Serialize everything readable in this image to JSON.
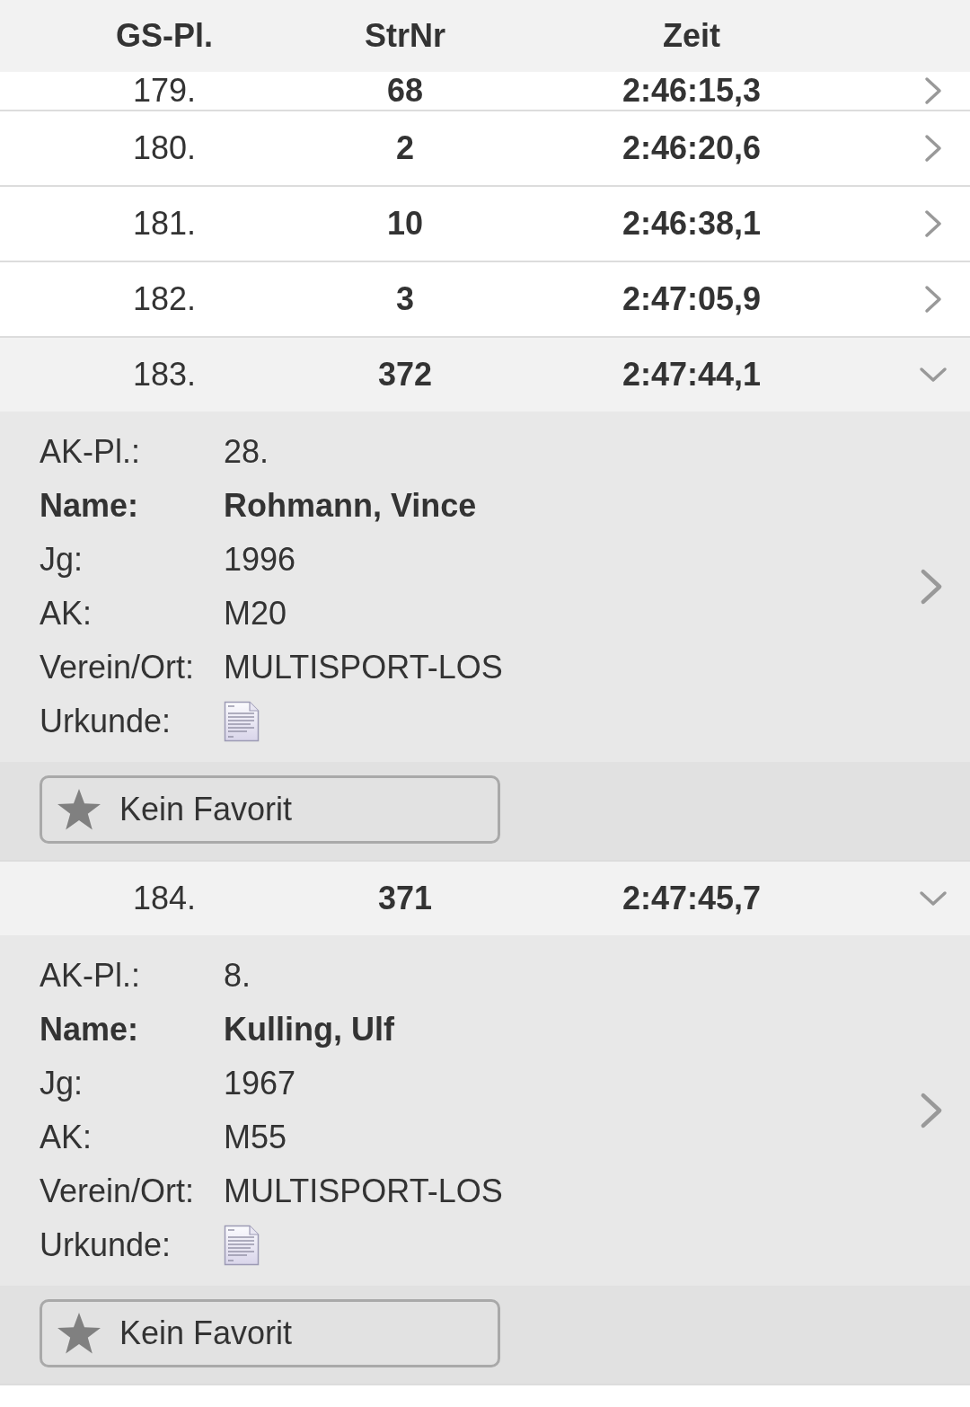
{
  "header": {
    "columns": [
      "GS-Pl.",
      "StrNr",
      "Zeit"
    ]
  },
  "rows": [
    {
      "place": "179.",
      "bib": "68",
      "time": "2:46:15,3",
      "expanded": false
    },
    {
      "place": "180.",
      "bib": "2",
      "time": "2:46:20,6",
      "expanded": false
    },
    {
      "place": "181.",
      "bib": "10",
      "time": "2:46:38,1",
      "expanded": false
    },
    {
      "place": "182.",
      "bib": "3",
      "time": "2:47:05,9",
      "expanded": false
    },
    {
      "place": "183.",
      "bib": "372",
      "time": "2:47:44,1",
      "expanded": true,
      "details": [
        {
          "kind": "text",
          "label": "AK-Pl.:",
          "value": "28."
        },
        {
          "kind": "bold",
          "label": "Name:",
          "value": "Rohmann, Vince"
        },
        {
          "kind": "text",
          "label": "Jg:",
          "value": "1996"
        },
        {
          "kind": "text",
          "label": "AK:",
          "value": "M20"
        },
        {
          "kind": "text",
          "label": "Verein/Ort:",
          "value": "MULTISPORT-LOS"
        },
        {
          "kind": "document",
          "label": "Urkunde:"
        }
      ],
      "favorite": {
        "label": "Kein Favorit",
        "on": false
      }
    },
    {
      "place": "184.",
      "bib": "371",
      "time": "2:47:45,7",
      "expanded": true,
      "details": [
        {
          "kind": "text",
          "label": "AK-Pl.:",
          "value": "8."
        },
        {
          "kind": "bold",
          "label": "Name:",
          "value": "Kulling, Ulf"
        },
        {
          "kind": "text",
          "label": "Jg:",
          "value": "1967"
        },
        {
          "kind": "text",
          "label": "AK:",
          "value": "M55"
        },
        {
          "kind": "text",
          "label": "Verein/Ort:",
          "value": "MULTISPORT-LOS"
        },
        {
          "kind": "document",
          "label": "Urkunde:"
        }
      ],
      "favorite": {
        "label": "Kein Favorit",
        "on": false
      }
    }
  ]
}
